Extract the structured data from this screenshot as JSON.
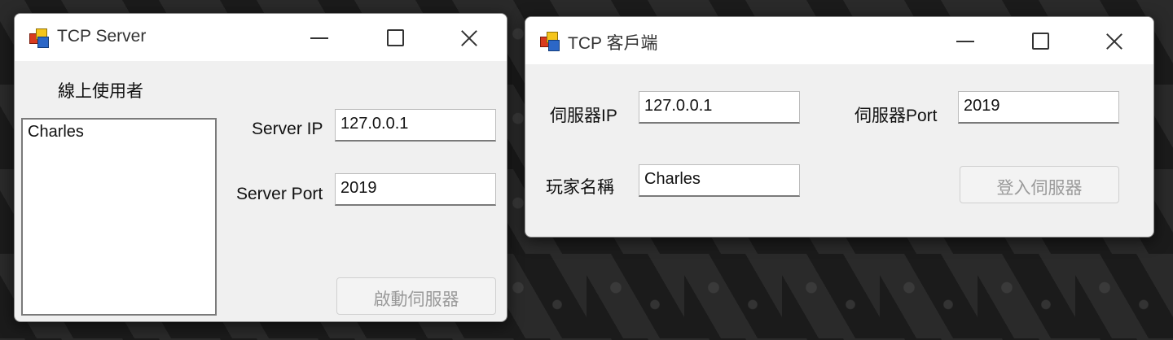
{
  "server": {
    "title": "TCP Server",
    "online_users_label": "線上使用者",
    "online_users": [
      "Charles"
    ],
    "ip_label": "Server IP",
    "ip_value": "127.0.0.1",
    "port_label": "Server Port",
    "port_value": "2019",
    "start_button": "啟動伺服器"
  },
  "client": {
    "title": "TCP 客戶端",
    "ip_label": "伺服器IP",
    "ip_value": "127.0.0.1",
    "port_label": "伺服器Port",
    "port_value": "2019",
    "name_label": "玩家名稱",
    "name_value": "Charles",
    "login_button": "登入伺服器"
  }
}
